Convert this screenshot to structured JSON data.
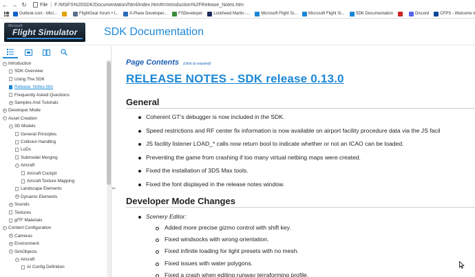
{
  "browser": {
    "file_label": "File",
    "url": "F:/MSFS%20SDK/Documentation/html/index.htm#t=Introduction%2FRelease_Notes.htm"
  },
  "bookmarks": [
    {
      "label": "Outlook.com - Micr...",
      "color": "#0a64c8"
    },
    {
      "label": "",
      "color": "#e0a200"
    },
    {
      "label": "FlightGear forum • I...",
      "color": "#5a6e8a"
    },
    {
      "label": "X-Plane Developer...",
      "color": "#2a6bb6"
    },
    {
      "label": "FSDeveloper",
      "color": "#3a8a3a"
    },
    {
      "label": "Lockheed Martin -...",
      "color": "#1c2f5c"
    },
    {
      "label": "Microsoft Flight Si...",
      "color": "#1b87d6"
    },
    {
      "label": "Microsoft Flight Si...",
      "color": "#1b87d6"
    },
    {
      "label": "SDK Documentation",
      "color": "#1b87d6"
    },
    {
      "label": "",
      "color": "#cc2222"
    },
    {
      "label": "Discord",
      "color": "#5865f2"
    },
    {
      "label": "CFPS - Welcome to...",
      "color": "#0a4a9a"
    }
  ],
  "header": {
    "logo_top": "Microsoft",
    "logo_main": "Flight Simulator",
    "title": "SDK Documentation"
  },
  "sidebar": {
    "tree": [
      {
        "label": "Introduction",
        "indent": 0,
        "kind": "toggle",
        "sign": "−"
      },
      {
        "label": "SDK Overview",
        "indent": 1,
        "kind": "doc"
      },
      {
        "label": "Using The SDK",
        "indent": 1,
        "kind": "doc"
      },
      {
        "label": "Release_Notes.htm",
        "indent": 1,
        "kind": "doc",
        "active": true
      },
      {
        "label": "Frequently Asked Questions",
        "indent": 1,
        "kind": "doc"
      },
      {
        "label": "Samples And Tutorials",
        "indent": 1,
        "kind": "toggle",
        "sign": "+"
      },
      {
        "label": "Developer Mode",
        "indent": 0,
        "kind": "toggle",
        "sign": "+"
      },
      {
        "label": "Asset Creation",
        "indent": 0,
        "kind": "toggle",
        "sign": "−"
      },
      {
        "label": "3D Models",
        "indent": 1,
        "kind": "toggle",
        "sign": "−"
      },
      {
        "label": "General Principles",
        "indent": 2,
        "kind": "doc"
      },
      {
        "label": "Collision Handling",
        "indent": 2,
        "kind": "doc"
      },
      {
        "label": "LoDs",
        "indent": 2,
        "kind": "doc"
      },
      {
        "label": "Submodel Merging",
        "indent": 2,
        "kind": "doc"
      },
      {
        "label": "Aircraft",
        "indent": 2,
        "kind": "toggle",
        "sign": "−"
      },
      {
        "label": "Aircraft Cockpit",
        "indent": 3,
        "kind": "doc"
      },
      {
        "label": "Aircraft Texture Mapping",
        "indent": 3,
        "kind": "doc"
      },
      {
        "label": "Landscape Elements",
        "indent": 2,
        "kind": "doc"
      },
      {
        "label": "Dynamic Elements",
        "indent": 2,
        "kind": "toggle",
        "sign": "+"
      },
      {
        "label": "Sounds",
        "indent": 1,
        "kind": "toggle",
        "sign": "+"
      },
      {
        "label": "Textures",
        "indent": 1,
        "kind": "doc"
      },
      {
        "label": "glTF Materials",
        "indent": 1,
        "kind": "doc"
      },
      {
        "label": "Content Configuration",
        "indent": 0,
        "kind": "toggle",
        "sign": "−"
      },
      {
        "label": "Cameras",
        "indent": 1,
        "kind": "toggle",
        "sign": "+"
      },
      {
        "label": "Environment",
        "indent": 1,
        "kind": "toggle",
        "sign": "+"
      },
      {
        "label": "SimObjects",
        "indent": 1,
        "kind": "toggle",
        "sign": "−"
      },
      {
        "label": "Aircraft",
        "indent": 2,
        "kind": "toggle",
        "sign": "−"
      },
      {
        "label": "AI Config Definition",
        "indent": 3,
        "kind": "doc"
      }
    ]
  },
  "content": {
    "page_contents": "Page Contents",
    "page_contents_hint": "(click to expand)",
    "release_title": "RELEASE NOTES - SDK release 0.13.0",
    "general_heading": "General",
    "general_items": [
      "Coherent GT's debugger is now included in the SDK.",
      "Speed restrictions and RF center fix information is now available on airport facility procedure data via the JS facil",
      "JS facility listener LOAD_* calls now return bool to indicate whether or not an ICAO can be loaded.",
      "Preventing the game from crashing if too many virtual netbing maps were created.",
      "Fixed the installation of 3DS Max tools.",
      "Fixed the font displayed in the release notes window."
    ],
    "devmode_heading": "Developer Mode Changes",
    "scenery_editor": "Scenery Editor:",
    "scenery_items": [
      "Added more precise gizmo control with shift key.",
      "Fixed windsocks with wrong orientation.",
      "Fixed infinite loading for light presets with no mesh.",
      "Fixed issues with water polygons.",
      "Fixed a crash when editing runway terraforming profile."
    ]
  }
}
